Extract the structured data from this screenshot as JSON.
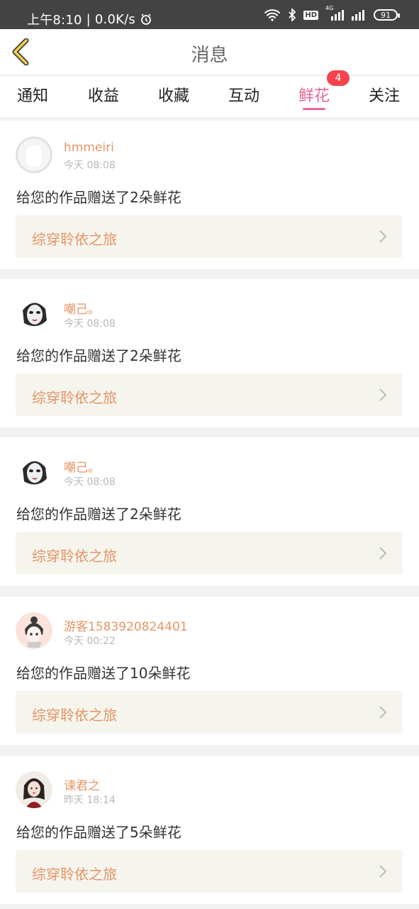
{
  "status_bar": {
    "time": "上午8:10",
    "net_speed": "0.0K/s",
    "hd": "HD",
    "net_type": "4G",
    "battery": "91"
  },
  "header": {
    "title": "消息"
  },
  "tabs": [
    {
      "label": "通知"
    },
    {
      "label": "收益"
    },
    {
      "label": "收藏"
    },
    {
      "label": "互动"
    },
    {
      "label": "鲜花",
      "badge": "4",
      "active": true
    },
    {
      "label": "关注"
    }
  ],
  "messages": [
    {
      "user": "hmmeiri",
      "time": "今天 08:08",
      "text": "给您的作品赠送了2朵鲜花",
      "work": "综穿聆依之旅",
      "avatar": "blank-avatar"
    },
    {
      "user": "嘲己。",
      "time": "今天 08:08",
      "text": "给您的作品赠送了2朵鲜花",
      "work": "综穿聆依之旅",
      "avatar": "mask-avatar"
    },
    {
      "user": "嘲己。",
      "time": "今天 08:08",
      "text": "给您的作品赠送了2朵鲜花",
      "work": "综穿聆依之旅",
      "avatar": "mask-avatar"
    },
    {
      "user": "游客1583920824401",
      "time": "今天 00:22",
      "text": "给您的作品赠送了10朵鲜花",
      "work": "综穿聆依之旅",
      "avatar": "cartoon-avatar"
    },
    {
      "user": "谏君之",
      "time": "昨天 18:14",
      "text": "给您的作品赠送了5朵鲜花",
      "work": "综穿聆依之旅",
      "avatar": "portrait-avatar"
    }
  ],
  "colors": {
    "accent": "#e8669b",
    "name": "#e59566",
    "badge": "#f5424d"
  }
}
